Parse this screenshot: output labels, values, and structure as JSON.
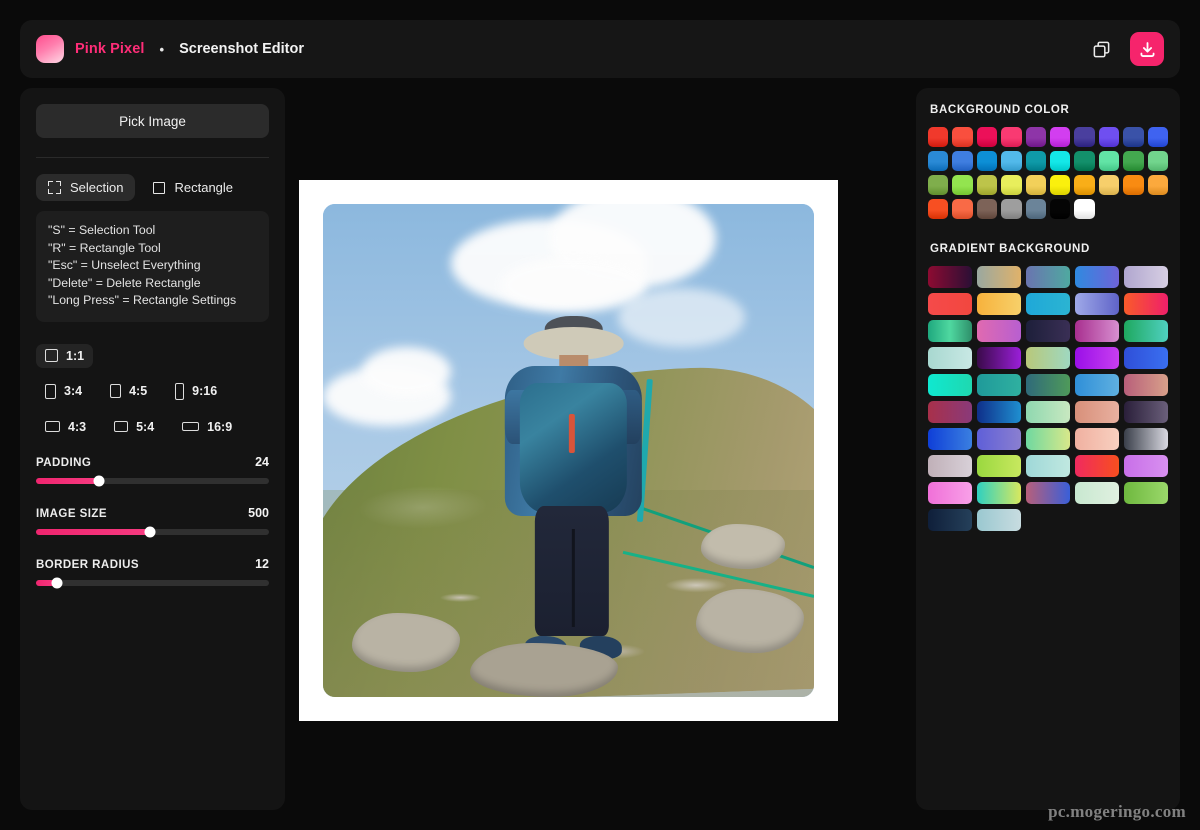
{
  "header": {
    "brand_name": "Pink Pixel",
    "separator": "•",
    "app_subtitle": "Screenshot Editor",
    "copy_icon": "copy-icon",
    "download_icon": "download-icon"
  },
  "sidebar": {
    "pick_image_label": "Pick Image",
    "tools": [
      {
        "label": "Selection",
        "icon": "marquee-icon",
        "active": true
      },
      {
        "label": "Rectangle",
        "icon": "square-icon",
        "active": false
      }
    ],
    "hints": [
      "\"S\" = Selection Tool",
      "\"R\" = Rectangle Tool",
      "\"Esc\" = Unselect Everything",
      "\"Delete\" = Delete Rectangle",
      "\"Long Press\" = Rectangle Settings"
    ],
    "ratios": [
      {
        "label": "1:1",
        "w": 13,
        "h": 13,
        "active": true
      },
      {
        "label": "3:4",
        "w": 11,
        "h": 15,
        "active": false
      },
      {
        "label": "4:5",
        "w": 11,
        "h": 14,
        "active": false
      },
      {
        "label": "9:16",
        "w": 9,
        "h": 17,
        "active": false
      },
      {
        "label": "4:3",
        "w": 15,
        "h": 11,
        "active": false
      },
      {
        "label": "5:4",
        "w": 14,
        "h": 11,
        "active": false
      },
      {
        "label": "16:9",
        "w": 17,
        "h": 9,
        "active": false
      }
    ],
    "sliders": [
      {
        "label": "PADDING",
        "value": "24",
        "percent": 27
      },
      {
        "label": "IMAGE SIZE",
        "value": "500",
        "percent": 49
      },
      {
        "label": "BORDER RADIUS",
        "value": "12",
        "percent": 9
      }
    ]
  },
  "canvas": {
    "background_color": "#ffffff",
    "photo_alt": "hiker-with-backpack-on-mountain-trail",
    "watermark": "pc.mogeringo.com"
  },
  "right_panel": {
    "background_color_title": "BACKGROUND COLOR",
    "gradient_background_title": "GRADIENT BACKGROUND",
    "solid_colors": [
      "#f0392c",
      "#f94f3e",
      "#ec1059",
      "#f93a72",
      "#8e35a8",
      "#d23ef0",
      "#4a3f9e",
      "#6f4ff0",
      "#3a52a8",
      "#3f63f0",
      "#2a8ad6",
      "#3f7ee0",
      "#0d8fd6",
      "#52b9ea",
      "#0f9aa8",
      "#14e8e8",
      "#13906b",
      "#62e4a6",
      "#43a84f",
      "#72d58d",
      "#7fae4c",
      "#93e44f",
      "#bdc44a",
      "#e8ee5c",
      "#f2d05a",
      "#faf00d",
      "#f9ae18",
      "#f7cf6b",
      "#f98b12",
      "#fba93d",
      "#f74f22",
      "#f96a46",
      "#7d6358",
      "#9e9e9e",
      "#6b8499",
      "#050505",
      "#ffffff"
    ],
    "gradients": [
      [
        "#8d0b32",
        "#2b0f35"
      ],
      [
        "#9aa8a0",
        "#e0b26a"
      ],
      [
        "#6a74b0",
        "#4fa9a0"
      ],
      [
        "#2f8ae0",
        "#6f63d8"
      ],
      [
        "#b0a6cf",
        "#d7cfe3"
      ],
      [
        "#f54a4a",
        "#f2473f"
      ],
      [
        "#f7b23c",
        "#f7d06a"
      ],
      [
        "#1fa8d8",
        "#2bb4d2"
      ],
      [
        "#9fa9e8",
        "#5f63c8"
      ],
      [
        "#f95b2a",
        "#ef1f6a"
      ],
      [
        "#1fa87e",
        "#4fd8a0",
        "#2e8f6a"
      ],
      [
        "#e06ab0",
        "#b85fd0"
      ],
      [
        "#1d1f3a",
        "#3a2f55"
      ],
      [
        "#a82f8f",
        "#d78fd0"
      ],
      [
        "#1fa85f",
        "#4fd0c0"
      ],
      [
        "#a8d8d0",
        "#c8e8e4"
      ],
      [
        "#3a0a4a",
        "#9a1fd8"
      ],
      [
        "#b8c87a",
        "#9fd8c0"
      ],
      [
        "#9a0fe8",
        "#c83ff0"
      ],
      [
        "#2f4fd8",
        "#3a6ff0"
      ],
      [
        "#0fe8d0",
        "#1fd8b0"
      ],
      [
        "#1f9a9a",
        "#2fb0a0"
      ],
      [
        "#2f6a7a",
        "#4f9a5a"
      ],
      [
        "#2f8fd8",
        "#5fb0e0"
      ],
      [
        "#b85f7a",
        "#d8a08a"
      ],
      [
        "#a8304a",
        "#8a3a7a"
      ],
      [
        "#0f2f8a",
        "#1f8fd0"
      ],
      [
        "#8fd8b0",
        "#c8e8c0"
      ],
      [
        "#d8907a",
        "#e8b0a0"
      ],
      [
        "#2a1f3a",
        "#6a5f7a"
      ],
      [
        "#0f3fd8",
        "#3a7fe0"
      ],
      [
        "#5f5fd8",
        "#8a7fd0"
      ],
      [
        "#6fd8a0",
        "#d8e88a"
      ],
      [
        "#f0b0a0",
        "#f8d0c0"
      ],
      [
        "#3a3f4a",
        "#d8d8e0"
      ],
      [
        "#c0b0b8",
        "#d8d0d8"
      ],
      [
        "#9ad83f",
        "#c8e85f"
      ],
      [
        "#9fd8d8",
        "#c0e8e0"
      ],
      [
        "#f02a5f",
        "#f74f1f"
      ],
      [
        "#c86fe8",
        "#d890f0"
      ],
      [
        "#f070d8",
        "#f8a0e8"
      ],
      [
        "#2fd0c0",
        "#d8e85f"
      ],
      [
        "#b85f7a",
        "#3a5fd8"
      ],
      [
        "#c8e8d0",
        "#e0f0e0"
      ],
      [
        "#6fb83f",
        "#9ad86a"
      ],
      [
        "#0f1f3a",
        "#25405a"
      ],
      [
        "#9ac8d0",
        "#c8dce0"
      ]
    ]
  }
}
